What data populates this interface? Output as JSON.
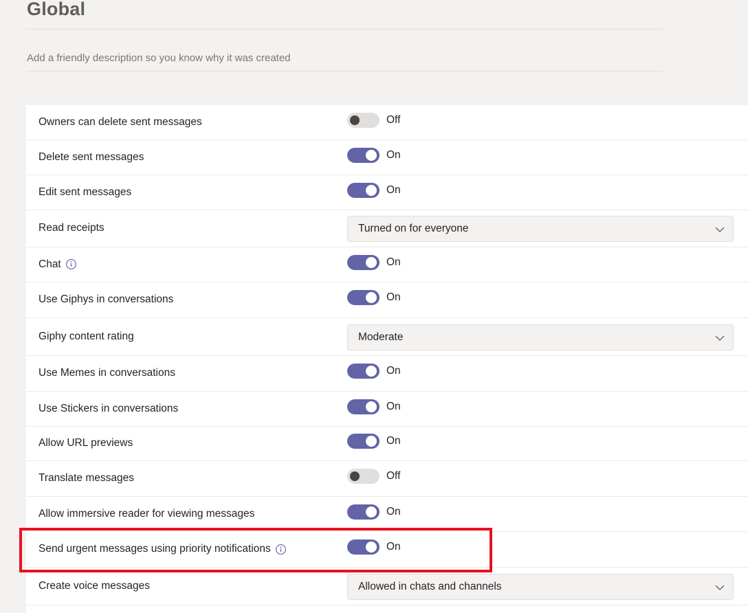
{
  "header": {
    "title": "Global",
    "description_placeholder": "Add a friendly description so you know why it was created"
  },
  "settings": [
    {
      "label": "Owners can delete sent messages",
      "type": "toggle",
      "state": "Off"
    },
    {
      "label": "Delete sent messages",
      "type": "toggle",
      "state": "On"
    },
    {
      "label": "Edit sent messages",
      "type": "toggle",
      "state": "On"
    },
    {
      "label": "Read receipts",
      "type": "dropdown",
      "value": "Turned on for everyone"
    },
    {
      "label": "Chat",
      "type": "toggle",
      "state": "On",
      "info_icon": true
    },
    {
      "label": "Use Giphys in conversations",
      "type": "toggle",
      "state": "On"
    },
    {
      "label": "Giphy content rating",
      "type": "dropdown",
      "value": "Moderate"
    },
    {
      "label": "Use Memes in conversations",
      "type": "toggle",
      "state": "On"
    },
    {
      "label": "Use Stickers in conversations",
      "type": "toggle",
      "state": "On"
    },
    {
      "label": "Allow URL previews",
      "type": "toggle",
      "state": "On"
    },
    {
      "label": "Translate messages",
      "type": "toggle",
      "state": "Off"
    },
    {
      "label": "Allow immersive reader for viewing messages",
      "type": "toggle",
      "state": "On"
    },
    {
      "label": "Send urgent messages using priority notifications",
      "type": "toggle",
      "state": "On",
      "info_icon": true,
      "highlighted": true
    },
    {
      "label": "Create voice messages",
      "type": "dropdown",
      "value": "Allowed in chats and channels"
    }
  ],
  "colors": {
    "toggle_on": "#6264a7",
    "toggle_off": "#e1dfdd",
    "highlight_border": "#e8111f"
  },
  "icons": {
    "info": "info-icon",
    "dropdown": "chevron-down-icon"
  }
}
